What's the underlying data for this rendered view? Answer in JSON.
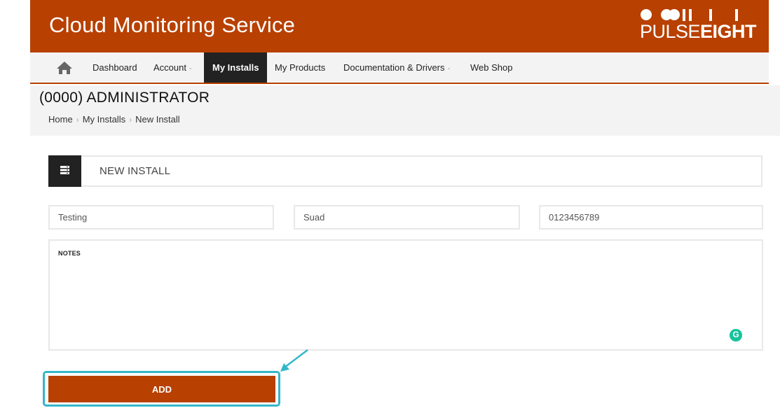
{
  "header": {
    "title": "Cloud Monitoring Service",
    "logo": {
      "light": "PULSE",
      "bold": "EIGHT"
    }
  },
  "nav": {
    "home_icon": "home-icon",
    "items": [
      {
        "label": "Dashboard"
      },
      {
        "label": "Account",
        "caret": "-"
      },
      {
        "label": "My Installs",
        "active": true
      },
      {
        "label": "My Products"
      },
      {
        "label": "Documentation & Drivers",
        "caret": "-"
      },
      {
        "label": "Web Shop"
      }
    ]
  },
  "page": {
    "title": "(0000)  ADMINISTRATOR",
    "breadcrumb": [
      "Home",
      "My Installs",
      "New Install"
    ]
  },
  "panel": {
    "icon": "list-server-icon",
    "title": "NEW INSTALL"
  },
  "form": {
    "company": {
      "value": "Testing"
    },
    "contact": {
      "value": "Suad"
    },
    "phone": {
      "value": "0123456789"
    },
    "notes_label": "NOTES",
    "notes_value": "",
    "grammarly_icon": "grammarly-icon",
    "grammarly_letter": "G"
  },
  "actions": {
    "add_label": "ADD"
  },
  "colors": {
    "brand": "#b84000",
    "nav_bg": "#f3f3f3",
    "active_nav": "#222222",
    "highlight": "#34b7c9",
    "grammarly": "#15c39a"
  }
}
